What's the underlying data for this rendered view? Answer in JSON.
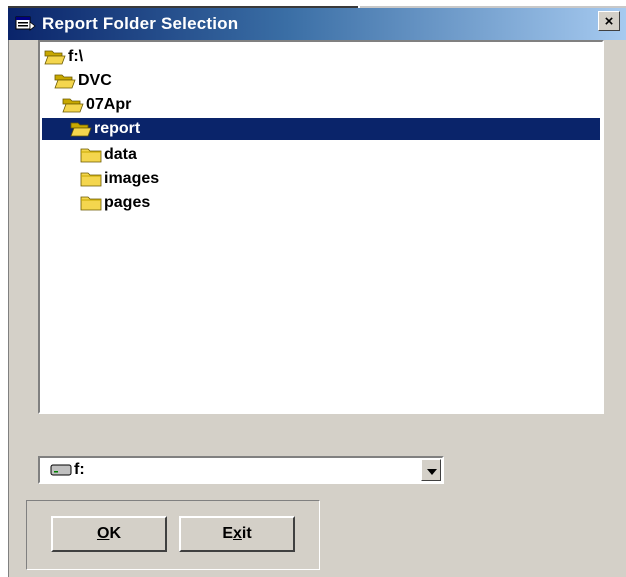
{
  "window": {
    "title": "Report Folder Selection",
    "close_label": "×",
    "icon": "window-app-icon"
  },
  "tree": {
    "items": [
      {
        "label": "f:\\",
        "icon": "open-folder-icon",
        "selected": false
      },
      {
        "label": "DVC",
        "icon": "open-folder-icon",
        "selected": false
      },
      {
        "label": "07Apr",
        "icon": "open-folder-icon",
        "selected": false
      },
      {
        "label": "report",
        "icon": "open-folder-icon",
        "selected": true
      },
      {
        "label": "data",
        "icon": "closed-folder-icon",
        "selected": false
      },
      {
        "label": "images",
        "icon": "closed-folder-icon",
        "selected": false
      },
      {
        "label": "pages",
        "icon": "closed-folder-icon",
        "selected": false
      }
    ]
  },
  "drive": {
    "selected": "f:",
    "icon": "drive-icon"
  },
  "buttons": {
    "ok": {
      "mnemonic": "O",
      "rest": "K"
    },
    "exit": {
      "before": "E",
      "mnemonic": "x",
      "after": "it"
    }
  },
  "colors": {
    "title_start": "#0a246a",
    "title_end": "#a6caf0",
    "selection": "#0a246a",
    "face": "#d4d0c8",
    "folder": "#f4d64e"
  }
}
